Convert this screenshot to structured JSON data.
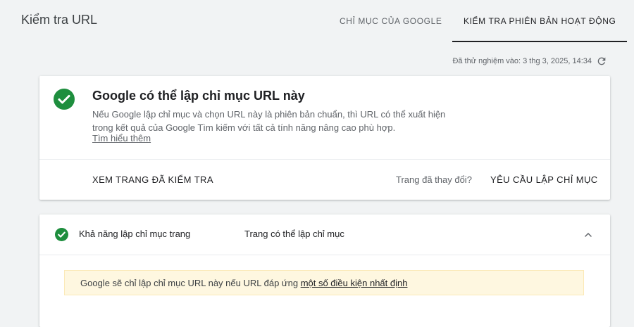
{
  "header": {
    "title": "Kiểm tra URL",
    "tabs": [
      {
        "label": "CHỈ MỤC CỦA GOOGLE",
        "active": false
      },
      {
        "label": "KIỂM TRA PHIÊN BẢN HOẠT ĐỘNG",
        "active": true
      }
    ]
  },
  "test_info": {
    "tested_text": "Đã thử nghiệm vào: 3 thg 3, 2025, 14:34",
    "refresh_icon": "refresh-icon"
  },
  "status_card": {
    "icon": "check-circle-icon",
    "status_color": "#1e8e3e",
    "headline": "Google có thể lập chỉ mục URL này",
    "description": "Nếu Google lập chỉ mục và chọn URL này là phiên bản chuẩn, thì URL có thể xuất hiện trong kết quả của Google Tìm kiếm với tất cả tính năng nâng cao phù hợp.",
    "learn_more": "Tìm hiểu thêm",
    "view_tested_page": "XEM TRANG ĐÃ KIỂM TRA",
    "page_changed": "Trang đã thay đổi?",
    "request_indexing": "YÊU CẦU LẬP CHỈ MỤC"
  },
  "detail_card": {
    "row_label": "Khả năng lập chỉ mục trang",
    "row_value": "Trang có thể lập chỉ mục",
    "chevron_icon": "chevron-up-icon",
    "notice_text": "Google sẽ chỉ lập chỉ mục URL này nếu URL đáp ứng ",
    "notice_link": "một số điều kiện nhất định",
    "notice_color": "#fef7e0"
  }
}
